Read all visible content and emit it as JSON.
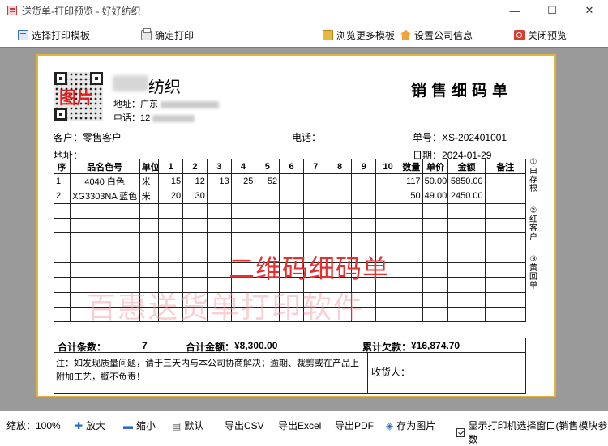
{
  "window": {
    "title": "送货单-打印预览 - 好好纺织",
    "controls": [
      "minimize",
      "maximize",
      "close"
    ]
  },
  "toolbar": {
    "select_template": "选择打印模板",
    "confirm_print": "确定打印",
    "browse_templates": "浏览更多模板",
    "company_settings": "设置公司信息",
    "close_preview": "关闭预览"
  },
  "doc": {
    "qr_label": "图片",
    "company_name": "纺织",
    "address_label": "地址：",
    "address_value": "广东",
    "phone_label": "电话：",
    "phone_value": "12",
    "title": "销售细码单",
    "customer_label": "客户：",
    "customer_value": "零售客户",
    "phone2_label": "电话：",
    "order_no_label": "单号：",
    "order_no_value": "XS-202401001",
    "addr2_label": "地址：",
    "date_label": "日期：",
    "date_value": "2024-01-29"
  },
  "table": {
    "headers": [
      "序",
      "品名色号",
      "单位",
      "1",
      "2",
      "3",
      "4",
      "5",
      "6",
      "7",
      "8",
      "9",
      "10",
      "数量",
      "单价",
      "金额",
      "备注"
    ],
    "rows": [
      [
        "1",
        "4040 白色",
        "米",
        "15",
        "12",
        "13",
        "25",
        "52",
        "",
        "",
        "",
        "",
        "",
        "117",
        "50.00",
        "5850.00",
        ""
      ],
      [
        "2",
        "XG3303NA 蓝色",
        "米",
        "20",
        "30",
        "",
        "",
        "",
        "",
        "",
        "",
        "",
        "",
        "50",
        "49.00",
        "2450.00",
        ""
      ]
    ],
    "empty_row_count": 8
  },
  "side_notes": [
    "①白存根",
    "②红客户",
    "③黄回单"
  ],
  "summary": {
    "count_label": "合计条数：",
    "count_value": "7",
    "amount_label": "合计金额：",
    "amount_value": "¥8,300.00",
    "debt_label": "累计欠款：",
    "debt_value": "¥16,874.70"
  },
  "note": "注：如发现质量问题，请于三天内与本公司协商解决；逾期、裁剪或在产品上附加工艺，概不负责！",
  "receiver_label": "收货人：",
  "watermarks": {
    "red": "二维码细码单",
    "pink": "百惠送货单打印软件"
  },
  "statusbar": {
    "zoom_label": "缩放：100%",
    "zoom_in": "放大",
    "zoom_out": "缩小",
    "default": "默认",
    "export_csv": "导出CSV",
    "export_excel": "导出Excel",
    "export_pdf": "导出PDF",
    "save_image": "存为图片",
    "show_printer_dialog": "显示打印机选择窗口(销售模块参数"
  }
}
